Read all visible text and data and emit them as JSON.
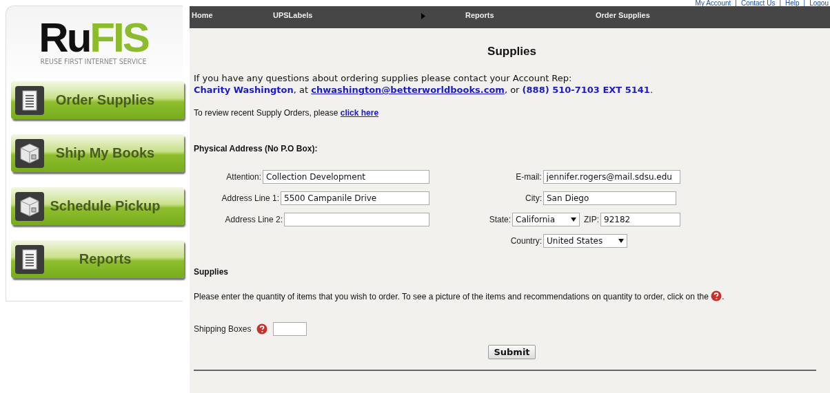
{
  "top_links": {
    "items": [
      "My Account",
      "Contact Us",
      "Help",
      "Logou"
    ],
    "separator": "|"
  },
  "logo": {
    "mark_left": "Ru",
    "mark_right": "FIS",
    "tagline": "REUSE FIRST INTERNET SERVICE"
  },
  "sidebar": {
    "items": [
      {
        "label": "Order Supplies",
        "kind": "document"
      },
      {
        "label": "Ship My Books",
        "kind": "box"
      },
      {
        "label": "Schedule Pickup",
        "kind": "box"
      },
      {
        "label": "Reports",
        "kind": "document"
      }
    ]
  },
  "nav": {
    "items": [
      {
        "label": "Home",
        "kind": "link"
      },
      {
        "label": "UPSLabels",
        "kind": "link"
      },
      {
        "kind": "arrow"
      },
      {
        "label": "Reports",
        "kind": "link"
      },
      {
        "label": "Order Supplies",
        "kind": "link"
      }
    ]
  },
  "page_title": "Supplies",
  "contact": {
    "intro": "If you have any questions about ordering supplies please contact your Account Rep:",
    "rep_name": "Charity Washington",
    "join_1": ", at",
    "email": "chwashington@betterworldbooks.com",
    "join_2": ", or",
    "phone": "(888) 510-7103 EXT 5141",
    "end": "."
  },
  "review": {
    "text": "To review recent Supply Orders, please",
    "link": "click here"
  },
  "address": {
    "heading": "Physical Address (No P.O Box):",
    "rows": [
      {
        "left": {
          "label": "Attention:",
          "value": "Collection Development"
        },
        "right": [
          {
            "label": "E-mail:",
            "value": "jennifer.rogers@mail.sdsu.edu",
            "kind": "text"
          }
        ]
      },
      {
        "left": {
          "label": "Address Line 1:",
          "value": "5500 Campanile Drive"
        },
        "right": [
          {
            "label": "City:",
            "value": "San Diego",
            "kind": "text"
          }
        ]
      },
      {
        "left": {
          "label": "Address Line 2:"
        },
        "right": [
          {
            "label": "State:",
            "value": "California",
            "kind": "select"
          },
          {
            "label": "ZIP:",
            "value": "92182",
            "kind": "text"
          }
        ]
      },
      {
        "right": [
          {
            "label": "Country:",
            "value": "United States",
            "kind": "select"
          }
        ]
      }
    ]
  },
  "supplies": {
    "heading": "Supplies",
    "instructions": "Please enter the quantity of items that you wish to order. To see a picture of the items and recommendations on quantity to order, click on the",
    "instructions_end": ".",
    "items": [
      {
        "label": "Shipping Boxes"
      }
    ],
    "submit": "Submit"
  }
}
